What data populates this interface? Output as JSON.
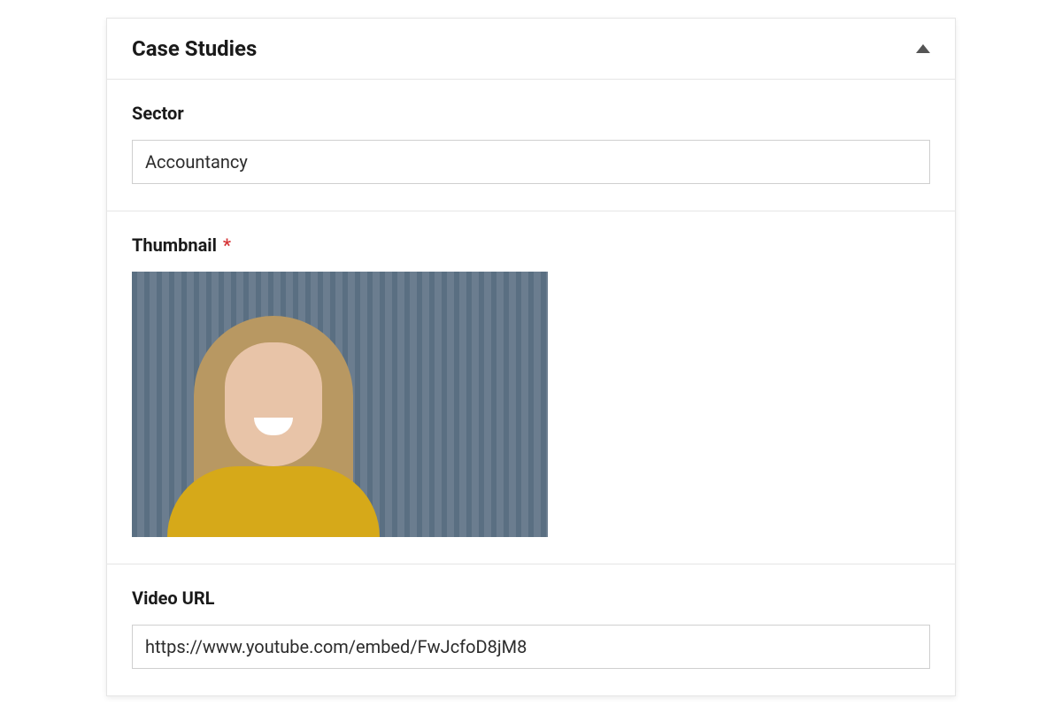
{
  "panel": {
    "title": "Case Studies"
  },
  "fields": {
    "sector": {
      "label": "Sector",
      "value": "Accountancy"
    },
    "thumbnail": {
      "label": "Thumbnail",
      "required_mark": "*"
    },
    "video_url": {
      "label": "Video URL",
      "value": "https://www.youtube.com/embed/FwJcfoD8jM8"
    }
  }
}
